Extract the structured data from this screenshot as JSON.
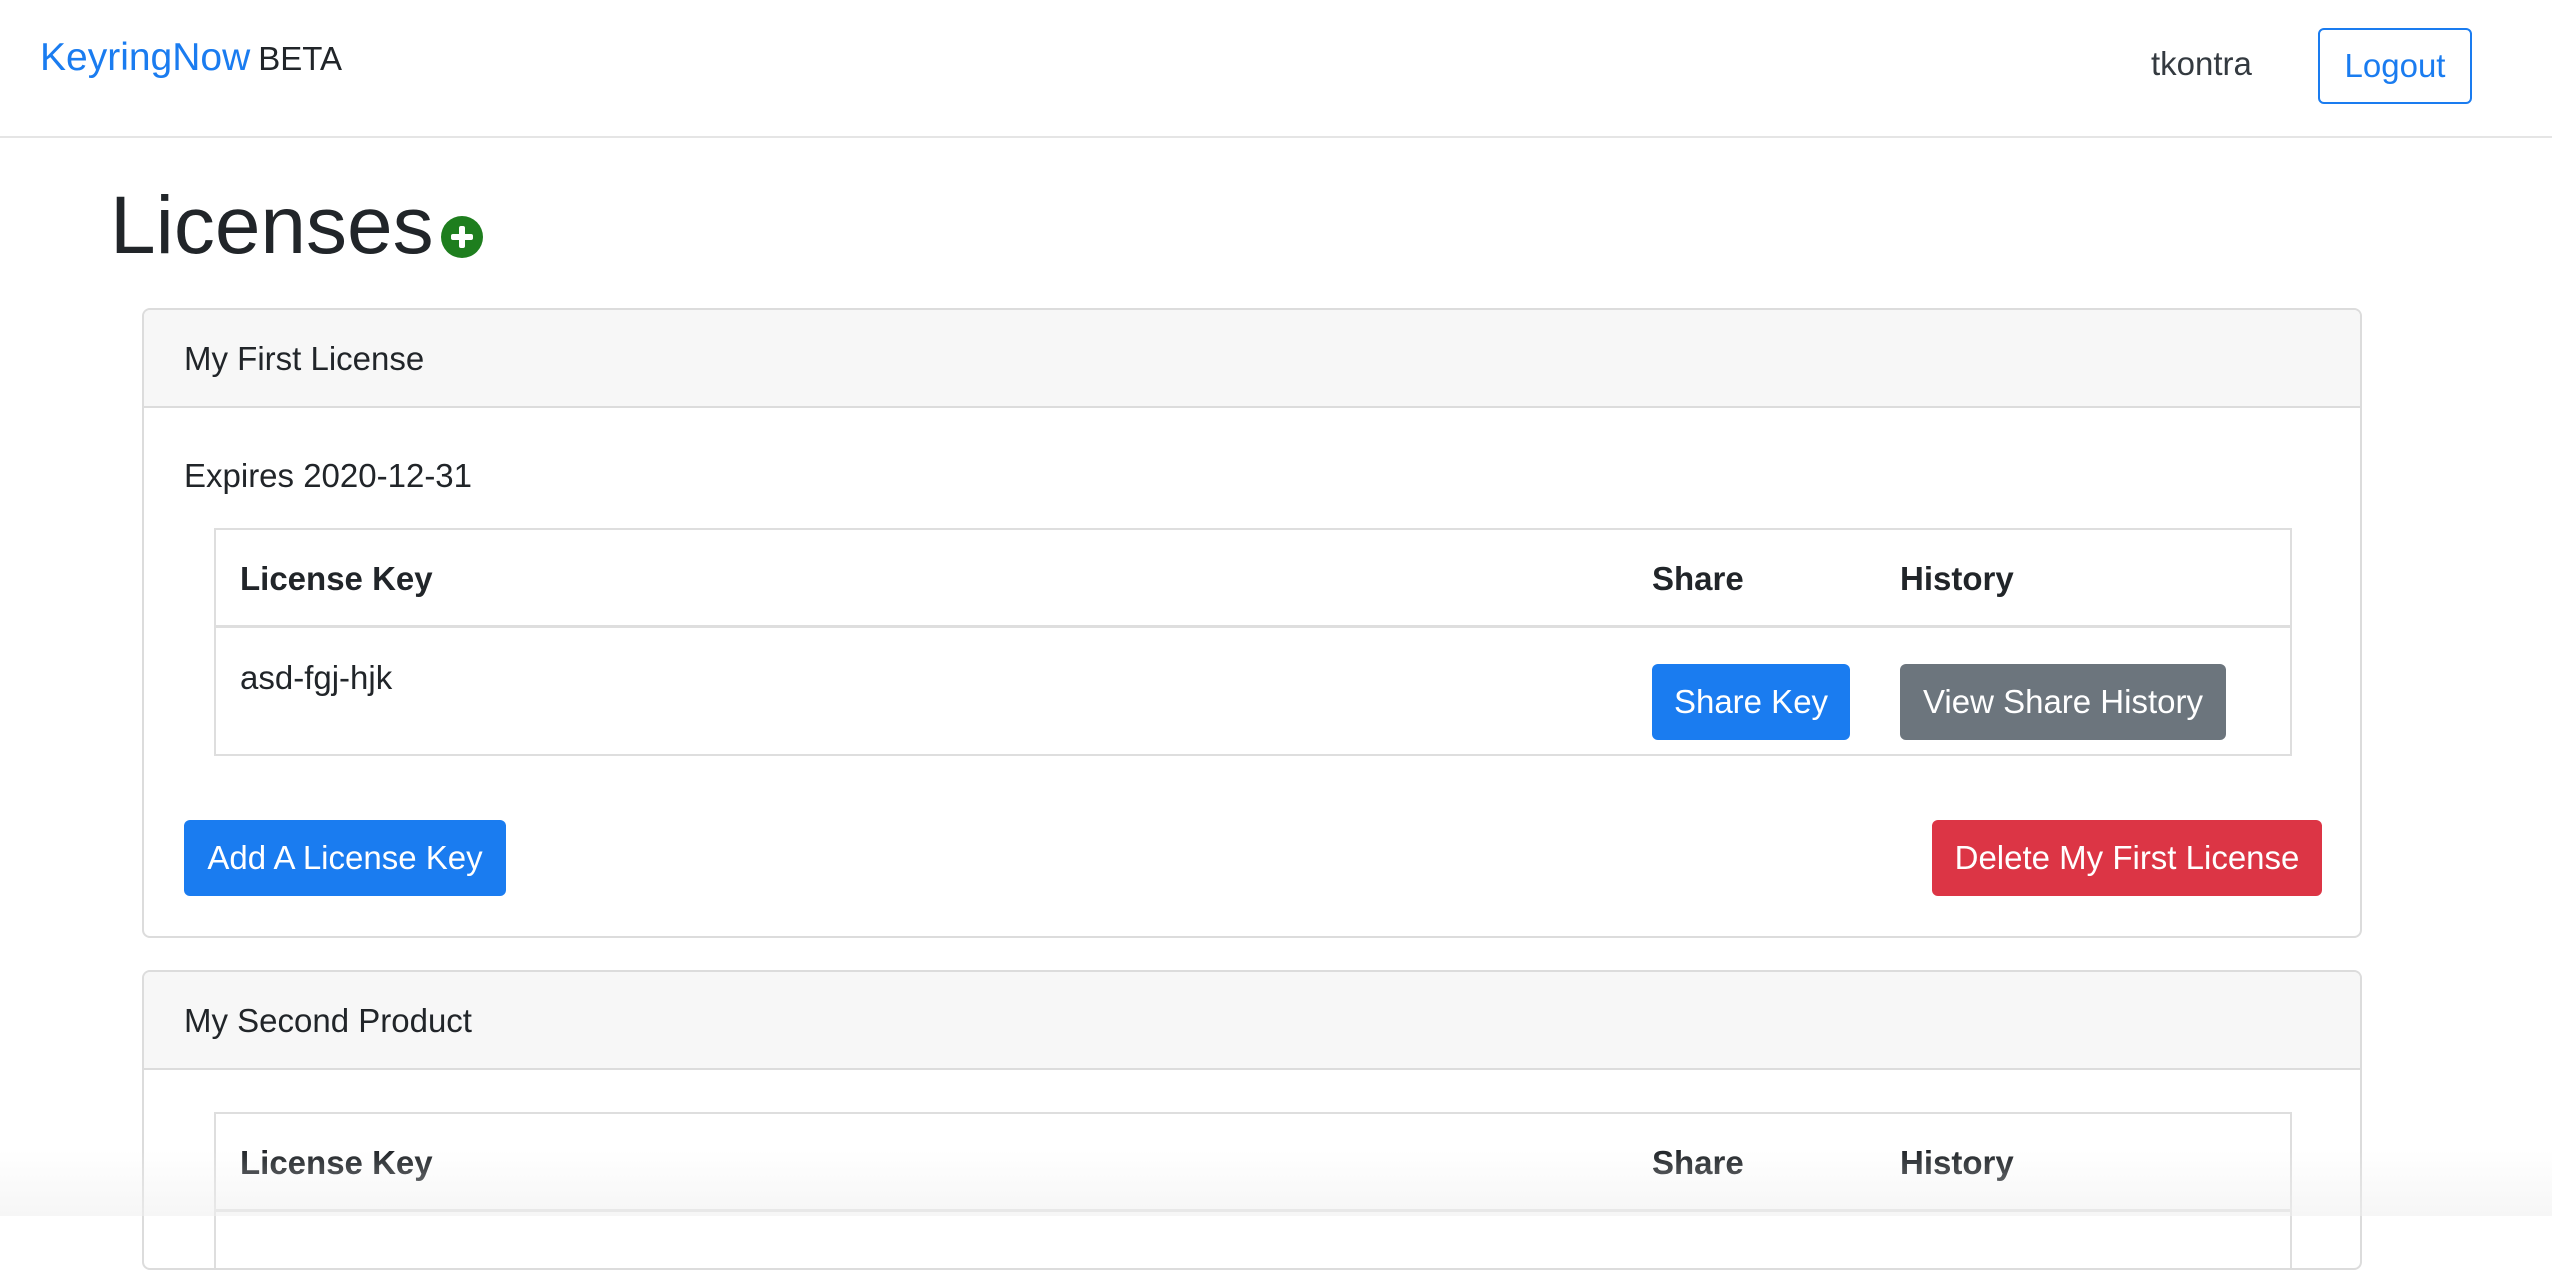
{
  "navbar": {
    "brand_name": "KeyringNow",
    "brand_badge": "BETA",
    "username": "tkontra",
    "logout_label": "Logout"
  },
  "page": {
    "title": "Licenses",
    "add_icon": "plus-circle-icon"
  },
  "licenses": [
    {
      "name": "My First License",
      "expires": "Expires 2020-12-31",
      "table": {
        "headers": [
          "License Key",
          "Share",
          "History"
        ],
        "rows": [
          {
            "key": "asd-fgj-hjk",
            "share_label": "Share Key",
            "history_label": "View Share History"
          }
        ]
      },
      "add_key_label": "Add A License Key",
      "delete_label": "Delete My First License"
    },
    {
      "name": "My Second Product",
      "table": {
        "headers": [
          "License Key",
          "Share",
          "History"
        ]
      }
    }
  ],
  "colors": {
    "primary": "#1a7cf0",
    "secondary": "#6c757d",
    "danger": "#dc3545",
    "success": "#1e7e1e"
  }
}
